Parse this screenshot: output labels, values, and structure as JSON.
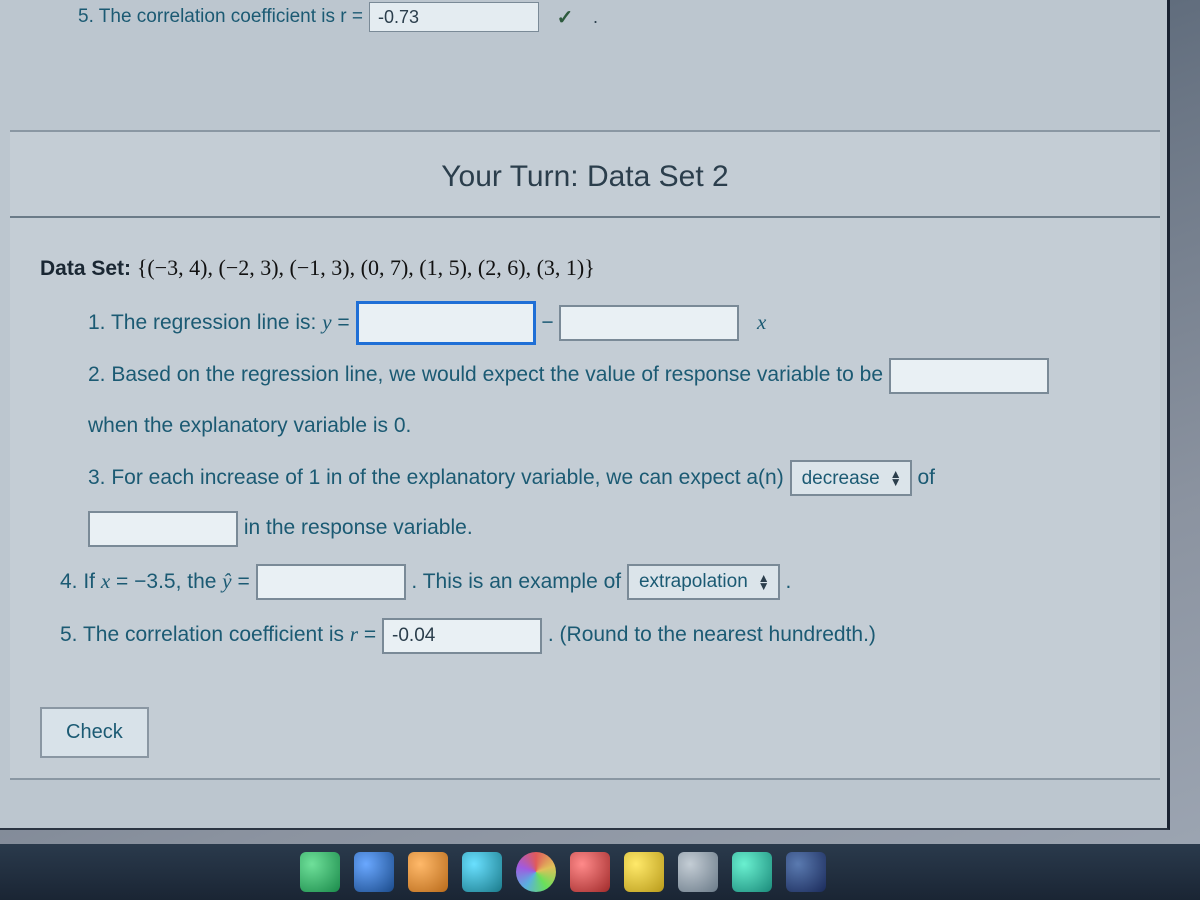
{
  "prev": {
    "q5_label": "5. The correlation coefficient is r =",
    "q5_value": "-0.73",
    "dot": "."
  },
  "panel": {
    "title": "Your Turn: Data Set 2"
  },
  "dataset": {
    "label": "Data Set:",
    "value": "{(−3, 4), (−2, 3), (−1, 3), (0, 7), (1, 5), (2, 6), (3, 1)}"
  },
  "q1": {
    "text": "1. The regression line is: y =",
    "minus": "−",
    "x": "x",
    "input_a": "",
    "input_b": ""
  },
  "q2": {
    "text_a": "2. Based on the regression line, we would expect the value of response variable to be",
    "input": "",
    "text_b": "when the explanatory variable is 0."
  },
  "q3": {
    "text_a": "3. For each increase of 1 in of the explanatory variable, we can expect a(n)",
    "select": "decrease",
    "of": "of",
    "input": "",
    "text_b": "in the response variable."
  },
  "q4": {
    "text_a": "4. If x = −3.5, the ŷ =",
    "input": "",
    "text_b": ". This is an example of",
    "select": "extrapolation",
    "period": "."
  },
  "q5": {
    "text_a": "5. The correlation coefficient is r =",
    "input": "-0.04",
    "text_b": ". (Round to the nearest hundredth.)"
  },
  "check_label": "Check"
}
